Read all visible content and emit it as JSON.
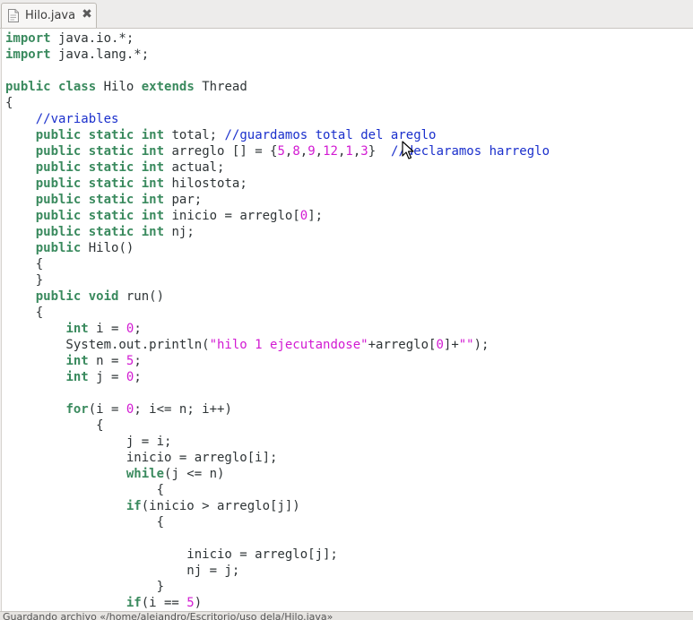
{
  "tab": {
    "title": "Hilo.java",
    "icon": "java-file-icon",
    "close_icon": "close-icon"
  },
  "status_bar": {
    "text": "Guardando archivo «/home/alejandro/Escritorio/uso dela/Hilo.java»"
  },
  "colors": {
    "keyword": "#3a8a5e",
    "comment": "#1a2fcc",
    "literal": "#d21ad2",
    "text": "#2e3436"
  },
  "code": {
    "lines": [
      [
        {
          "t": "import",
          "k": "kw"
        },
        {
          "t": " java.io.*;",
          "k": "id"
        }
      ],
      [
        {
          "t": "import",
          "k": "kw"
        },
        {
          "t": " java.lang.*;",
          "k": "id"
        }
      ],
      [],
      [
        {
          "t": "public",
          "k": "kw"
        },
        {
          "t": " ",
          "k": "id"
        },
        {
          "t": "class",
          "k": "kw"
        },
        {
          "t": " Hilo ",
          "k": "id"
        },
        {
          "t": "extends",
          "k": "kw"
        },
        {
          "t": " Thread",
          "k": "id"
        }
      ],
      [
        {
          "t": "{",
          "k": "id"
        }
      ],
      [
        {
          "t": "    ",
          "k": "id"
        },
        {
          "t": "//variables",
          "k": "cm"
        }
      ],
      [
        {
          "t": "    ",
          "k": "id"
        },
        {
          "t": "public",
          "k": "kw"
        },
        {
          "t": " ",
          "k": "id"
        },
        {
          "t": "static",
          "k": "kw"
        },
        {
          "t": " ",
          "k": "id"
        },
        {
          "t": "int",
          "k": "type"
        },
        {
          "t": " total; ",
          "k": "id"
        },
        {
          "t": "//guardamos total del areglo",
          "k": "cm"
        }
      ],
      [
        {
          "t": "    ",
          "k": "id"
        },
        {
          "t": "public",
          "k": "kw"
        },
        {
          "t": " ",
          "k": "id"
        },
        {
          "t": "static",
          "k": "kw"
        },
        {
          "t": " ",
          "k": "id"
        },
        {
          "t": "int",
          "k": "type"
        },
        {
          "t": " arreglo [] = {",
          "k": "id"
        },
        {
          "t": "5",
          "k": "num"
        },
        {
          "t": ",",
          "k": "id"
        },
        {
          "t": "8",
          "k": "num"
        },
        {
          "t": ",",
          "k": "id"
        },
        {
          "t": "9",
          "k": "num"
        },
        {
          "t": ",",
          "k": "id"
        },
        {
          "t": "12",
          "k": "num"
        },
        {
          "t": ",",
          "k": "id"
        },
        {
          "t": "1",
          "k": "num"
        },
        {
          "t": ",",
          "k": "id"
        },
        {
          "t": "3",
          "k": "num"
        },
        {
          "t": "}  ",
          "k": "id"
        },
        {
          "t": "//declaramos harreglo",
          "k": "cm"
        }
      ],
      [
        {
          "t": "    ",
          "k": "id"
        },
        {
          "t": "public",
          "k": "kw"
        },
        {
          "t": " ",
          "k": "id"
        },
        {
          "t": "static",
          "k": "kw"
        },
        {
          "t": " ",
          "k": "id"
        },
        {
          "t": "int",
          "k": "type"
        },
        {
          "t": " actual;",
          "k": "id"
        }
      ],
      [
        {
          "t": "    ",
          "k": "id"
        },
        {
          "t": "public",
          "k": "kw"
        },
        {
          "t": " ",
          "k": "id"
        },
        {
          "t": "static",
          "k": "kw"
        },
        {
          "t": " ",
          "k": "id"
        },
        {
          "t": "int",
          "k": "type"
        },
        {
          "t": " hilostota;",
          "k": "id"
        }
      ],
      [
        {
          "t": "    ",
          "k": "id"
        },
        {
          "t": "public",
          "k": "kw"
        },
        {
          "t": " ",
          "k": "id"
        },
        {
          "t": "static",
          "k": "kw"
        },
        {
          "t": " ",
          "k": "id"
        },
        {
          "t": "int",
          "k": "type"
        },
        {
          "t": " par;",
          "k": "id"
        }
      ],
      [
        {
          "t": "    ",
          "k": "id"
        },
        {
          "t": "public",
          "k": "kw"
        },
        {
          "t": " ",
          "k": "id"
        },
        {
          "t": "static",
          "k": "kw"
        },
        {
          "t": " ",
          "k": "id"
        },
        {
          "t": "int",
          "k": "type"
        },
        {
          "t": " inicio = arreglo[",
          "k": "id"
        },
        {
          "t": "0",
          "k": "num"
        },
        {
          "t": "];",
          "k": "id"
        }
      ],
      [
        {
          "t": "    ",
          "k": "id"
        },
        {
          "t": "public",
          "k": "kw"
        },
        {
          "t": " ",
          "k": "id"
        },
        {
          "t": "static",
          "k": "kw"
        },
        {
          "t": " ",
          "k": "id"
        },
        {
          "t": "int",
          "k": "type"
        },
        {
          "t": " nj;",
          "k": "id"
        }
      ],
      [
        {
          "t": "    ",
          "k": "id"
        },
        {
          "t": "public",
          "k": "kw"
        },
        {
          "t": " Hilo()",
          "k": "fn"
        }
      ],
      [
        {
          "t": "    {",
          "k": "id"
        }
      ],
      [
        {
          "t": "    }",
          "k": "id"
        }
      ],
      [
        {
          "t": "    ",
          "k": "id"
        },
        {
          "t": "public",
          "k": "kw"
        },
        {
          "t": " ",
          "k": "id"
        },
        {
          "t": "void",
          "k": "type"
        },
        {
          "t": " run()",
          "k": "fn"
        }
      ],
      [
        {
          "t": "    {",
          "k": "id"
        }
      ],
      [
        {
          "t": "        ",
          "k": "id"
        },
        {
          "t": "int",
          "k": "type"
        },
        {
          "t": " i = ",
          "k": "id"
        },
        {
          "t": "0",
          "k": "num"
        },
        {
          "t": ";",
          "k": "id"
        }
      ],
      [
        {
          "t": "        System.out.println(",
          "k": "id"
        },
        {
          "t": "\"hilo 1 ejecutandose\"",
          "k": "str"
        },
        {
          "t": "+arreglo[",
          "k": "id"
        },
        {
          "t": "0",
          "k": "num"
        },
        {
          "t": "]+",
          "k": "id"
        },
        {
          "t": "\"\"",
          "k": "str"
        },
        {
          "t": ");",
          "k": "id"
        }
      ],
      [
        {
          "t": "        ",
          "k": "id"
        },
        {
          "t": "int",
          "k": "type"
        },
        {
          "t": " n = ",
          "k": "id"
        },
        {
          "t": "5",
          "k": "num"
        },
        {
          "t": ";",
          "k": "id"
        }
      ],
      [
        {
          "t": "        ",
          "k": "id"
        },
        {
          "t": "int",
          "k": "type"
        },
        {
          "t": " j = ",
          "k": "id"
        },
        {
          "t": "0",
          "k": "num"
        },
        {
          "t": ";",
          "k": "id"
        }
      ],
      [],
      [
        {
          "t": "        ",
          "k": "id"
        },
        {
          "t": "for",
          "k": "kw"
        },
        {
          "t": "(i = ",
          "k": "id"
        },
        {
          "t": "0",
          "k": "num"
        },
        {
          "t": "; i<= n; i++)",
          "k": "id"
        }
      ],
      [
        {
          "t": "            {",
          "k": "id"
        }
      ],
      [
        {
          "t": "                j = i;",
          "k": "id"
        }
      ],
      [
        {
          "t": "                inicio = arreglo[i];",
          "k": "id"
        }
      ],
      [
        {
          "t": "                ",
          "k": "id"
        },
        {
          "t": "while",
          "k": "kw"
        },
        {
          "t": "(j <= n)",
          "k": "id"
        }
      ],
      [
        {
          "t": "                    {",
          "k": "id"
        }
      ],
      [
        {
          "t": "                ",
          "k": "id"
        },
        {
          "t": "if",
          "k": "kw"
        },
        {
          "t": "(inicio > arreglo[j])",
          "k": "id"
        }
      ],
      [
        {
          "t": "                    {",
          "k": "id"
        }
      ],
      [],
      [
        {
          "t": "                        inicio = arreglo[j];",
          "k": "id"
        }
      ],
      [
        {
          "t": "                        nj = j;",
          "k": "id"
        }
      ],
      [
        {
          "t": "                    }",
          "k": "id"
        }
      ],
      [
        {
          "t": "                ",
          "k": "id"
        },
        {
          "t": "if",
          "k": "kw"
        },
        {
          "t": "(i == ",
          "k": "id"
        },
        {
          "t": "5",
          "k": "num"
        },
        {
          "t": ")",
          "k": "id"
        }
      ]
    ]
  }
}
